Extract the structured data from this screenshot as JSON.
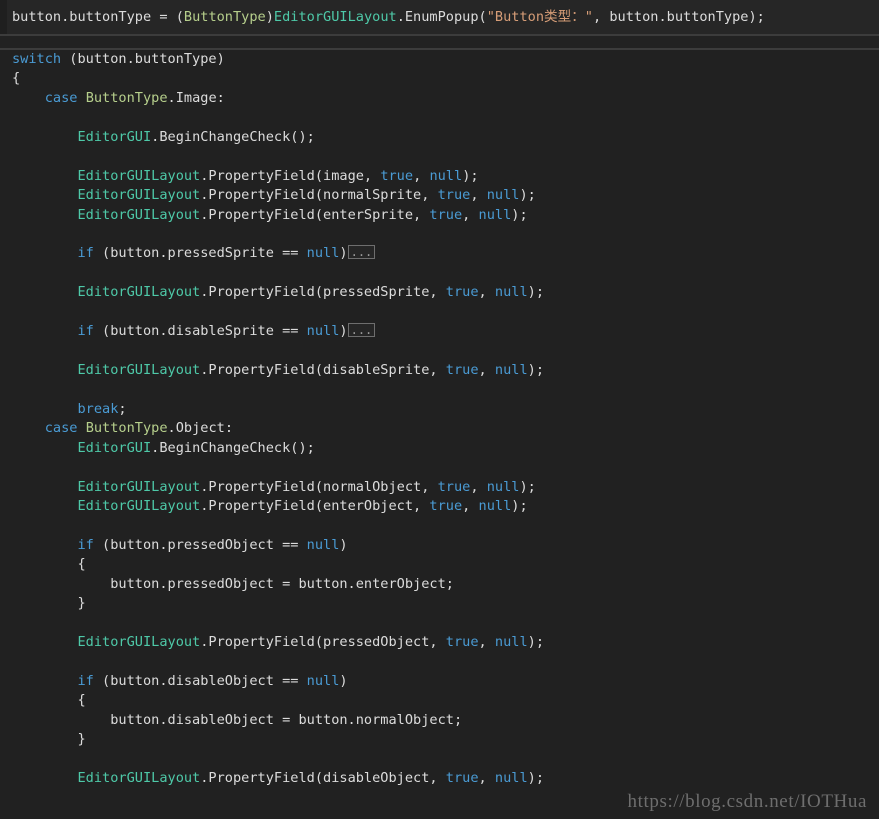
{
  "editor": {
    "language": "C#",
    "theme": "dark",
    "colors": {
      "background": "#212121",
      "header_background": "#262626",
      "gutter": "#1b1b1b",
      "divider": "#3c3c3c",
      "foreground": "#dcdcdc",
      "keyword": "#4a9bd4",
      "type": "#b6cf8c",
      "class": "#4ec9a8",
      "string": "#d69d77",
      "collapsed_border": "#6e6e6e",
      "collapsed_text": "#9a9a9a",
      "watermark": "#6e6e6e"
    }
  },
  "sticky_header": {
    "tokens": [
      {
        "t": "button.buttonType ",
        "c": "plain"
      },
      {
        "t": "= ",
        "c": "plain"
      },
      {
        "t": "(",
        "c": "plain"
      },
      {
        "t": "ButtonType",
        "c": "type"
      },
      {
        "t": ")",
        "c": "plain"
      },
      {
        "t": "EditorGUILayout",
        "c": "cls"
      },
      {
        "t": ".EnumPopup(",
        "c": "plain"
      },
      {
        "t": "\"Button类型：\"",
        "c": "str"
      },
      {
        "t": ", button.buttonType);",
        "c": "plain"
      }
    ],
    "text": "button.buttonType = (ButtonType)EditorGUILayout.EnumPopup(\"Button类型：\", button.buttonType);"
  },
  "code_lines": [
    {
      "indent": 0,
      "tokens": [
        {
          "t": "switch",
          "c": "kw"
        },
        {
          "t": " (button.buttonType)",
          "c": "plain"
        }
      ]
    },
    {
      "indent": 0,
      "tokens": [
        {
          "t": "{",
          "c": "brace"
        }
      ]
    },
    {
      "indent": 1,
      "tokens": [
        {
          "t": "case",
          "c": "kw"
        },
        {
          "t": " ",
          "c": "plain"
        },
        {
          "t": "ButtonType",
          "c": "type"
        },
        {
          "t": ".Image:",
          "c": "plain"
        }
      ]
    },
    {
      "indent": 0,
      "tokens": []
    },
    {
      "indent": 2,
      "tokens": [
        {
          "t": "EditorGUI",
          "c": "cls"
        },
        {
          "t": ".BeginChangeCheck();",
          "c": "plain"
        }
      ]
    },
    {
      "indent": 0,
      "tokens": []
    },
    {
      "indent": 2,
      "tokens": [
        {
          "t": "EditorGUILayout",
          "c": "cls"
        },
        {
          "t": ".PropertyField(image, ",
          "c": "plain"
        },
        {
          "t": "true",
          "c": "kw"
        },
        {
          "t": ", ",
          "c": "plain"
        },
        {
          "t": "null",
          "c": "kw"
        },
        {
          "t": ");",
          "c": "plain"
        }
      ]
    },
    {
      "indent": 2,
      "tokens": [
        {
          "t": "EditorGUILayout",
          "c": "cls"
        },
        {
          "t": ".PropertyField(normalSprite, ",
          "c": "plain"
        },
        {
          "t": "true",
          "c": "kw"
        },
        {
          "t": ", ",
          "c": "plain"
        },
        {
          "t": "null",
          "c": "kw"
        },
        {
          "t": ");",
          "c": "plain"
        }
      ]
    },
    {
      "indent": 2,
      "tokens": [
        {
          "t": "EditorGUILayout",
          "c": "cls"
        },
        {
          "t": ".PropertyField(enterSprite, ",
          "c": "plain"
        },
        {
          "t": "true",
          "c": "kw"
        },
        {
          "t": ", ",
          "c": "plain"
        },
        {
          "t": "null",
          "c": "kw"
        },
        {
          "t": ");",
          "c": "plain"
        }
      ]
    },
    {
      "indent": 0,
      "tokens": []
    },
    {
      "indent": 2,
      "tokens": [
        {
          "t": "if",
          "c": "kw"
        },
        {
          "t": " (button.pressedSprite == ",
          "c": "plain"
        },
        {
          "t": "null",
          "c": "kw"
        },
        {
          "t": ")",
          "c": "plain"
        }
      ],
      "collapsed": "..."
    },
    {
      "indent": 0,
      "tokens": []
    },
    {
      "indent": 2,
      "tokens": [
        {
          "t": "EditorGUILayout",
          "c": "cls"
        },
        {
          "t": ".PropertyField(pressedSprite, ",
          "c": "plain"
        },
        {
          "t": "true",
          "c": "kw"
        },
        {
          "t": ", ",
          "c": "plain"
        },
        {
          "t": "null",
          "c": "kw"
        },
        {
          "t": ");",
          "c": "plain"
        }
      ]
    },
    {
      "indent": 0,
      "tokens": []
    },
    {
      "indent": 2,
      "tokens": [
        {
          "t": "if",
          "c": "kw"
        },
        {
          "t": " (button.disableSprite == ",
          "c": "plain"
        },
        {
          "t": "null",
          "c": "kw"
        },
        {
          "t": ")",
          "c": "plain"
        }
      ],
      "collapsed": "..."
    },
    {
      "indent": 0,
      "tokens": []
    },
    {
      "indent": 2,
      "tokens": [
        {
          "t": "EditorGUILayout",
          "c": "cls"
        },
        {
          "t": ".PropertyField(disableSprite, ",
          "c": "plain"
        },
        {
          "t": "true",
          "c": "kw"
        },
        {
          "t": ", ",
          "c": "plain"
        },
        {
          "t": "null",
          "c": "kw"
        },
        {
          "t": ");",
          "c": "plain"
        }
      ]
    },
    {
      "indent": 0,
      "tokens": []
    },
    {
      "indent": 2,
      "tokens": [
        {
          "t": "break",
          "c": "kw"
        },
        {
          "t": ";",
          "c": "plain"
        }
      ]
    },
    {
      "indent": 1,
      "tokens": [
        {
          "t": "case",
          "c": "kw"
        },
        {
          "t": " ",
          "c": "plain"
        },
        {
          "t": "ButtonType",
          "c": "type"
        },
        {
          "t": ".Object:",
          "c": "plain"
        }
      ]
    },
    {
      "indent": 2,
      "tokens": [
        {
          "t": "EditorGUI",
          "c": "cls"
        },
        {
          "t": ".BeginChangeCheck();",
          "c": "plain"
        }
      ]
    },
    {
      "indent": 0,
      "tokens": []
    },
    {
      "indent": 2,
      "tokens": [
        {
          "t": "EditorGUILayout",
          "c": "cls"
        },
        {
          "t": ".PropertyField(normalObject, ",
          "c": "plain"
        },
        {
          "t": "true",
          "c": "kw"
        },
        {
          "t": ", ",
          "c": "plain"
        },
        {
          "t": "null",
          "c": "kw"
        },
        {
          "t": ");",
          "c": "plain"
        }
      ]
    },
    {
      "indent": 2,
      "tokens": [
        {
          "t": "EditorGUILayout",
          "c": "cls"
        },
        {
          "t": ".PropertyField(enterObject, ",
          "c": "plain"
        },
        {
          "t": "true",
          "c": "kw"
        },
        {
          "t": ", ",
          "c": "plain"
        },
        {
          "t": "null",
          "c": "kw"
        },
        {
          "t": ");",
          "c": "plain"
        }
      ]
    },
    {
      "indent": 0,
      "tokens": []
    },
    {
      "indent": 2,
      "tokens": [
        {
          "t": "if",
          "c": "kw"
        },
        {
          "t": " (button.pressedObject == ",
          "c": "plain"
        },
        {
          "t": "null",
          "c": "kw"
        },
        {
          "t": ")",
          "c": "plain"
        }
      ]
    },
    {
      "indent": 2,
      "tokens": [
        {
          "t": "{",
          "c": "brace"
        }
      ]
    },
    {
      "indent": 3,
      "tokens": [
        {
          "t": "button.pressedObject = button.enterObject;",
          "c": "plain"
        }
      ]
    },
    {
      "indent": 2,
      "tokens": [
        {
          "t": "}",
          "c": "brace"
        }
      ]
    },
    {
      "indent": 0,
      "tokens": []
    },
    {
      "indent": 2,
      "tokens": [
        {
          "t": "EditorGUILayout",
          "c": "cls"
        },
        {
          "t": ".PropertyField(pressedObject, ",
          "c": "plain"
        },
        {
          "t": "true",
          "c": "kw"
        },
        {
          "t": ", ",
          "c": "plain"
        },
        {
          "t": "null",
          "c": "kw"
        },
        {
          "t": ");",
          "c": "plain"
        }
      ]
    },
    {
      "indent": 0,
      "tokens": []
    },
    {
      "indent": 2,
      "tokens": [
        {
          "t": "if",
          "c": "kw"
        },
        {
          "t": " (button.disableObject == ",
          "c": "plain"
        },
        {
          "t": "null",
          "c": "kw"
        },
        {
          "t": ")",
          "c": "plain"
        }
      ]
    },
    {
      "indent": 2,
      "tokens": [
        {
          "t": "{",
          "c": "brace"
        }
      ]
    },
    {
      "indent": 3,
      "tokens": [
        {
          "t": "button.disableObject = button.normalObject;",
          "c": "plain"
        }
      ]
    },
    {
      "indent": 2,
      "tokens": [
        {
          "t": "}",
          "c": "brace"
        }
      ]
    },
    {
      "indent": 0,
      "tokens": []
    },
    {
      "indent": 2,
      "tokens": [
        {
          "t": "EditorGUILayout",
          "c": "cls"
        },
        {
          "t": ".PropertyField(disableObject, ",
          "c": "plain"
        },
        {
          "t": "true",
          "c": "kw"
        },
        {
          "t": ", ",
          "c": "plain"
        },
        {
          "t": "null",
          "c": "kw"
        },
        {
          "t": ");",
          "c": "plain"
        }
      ]
    }
  ],
  "watermark": {
    "text": "https://blog.csdn.net/IOTHua"
  }
}
